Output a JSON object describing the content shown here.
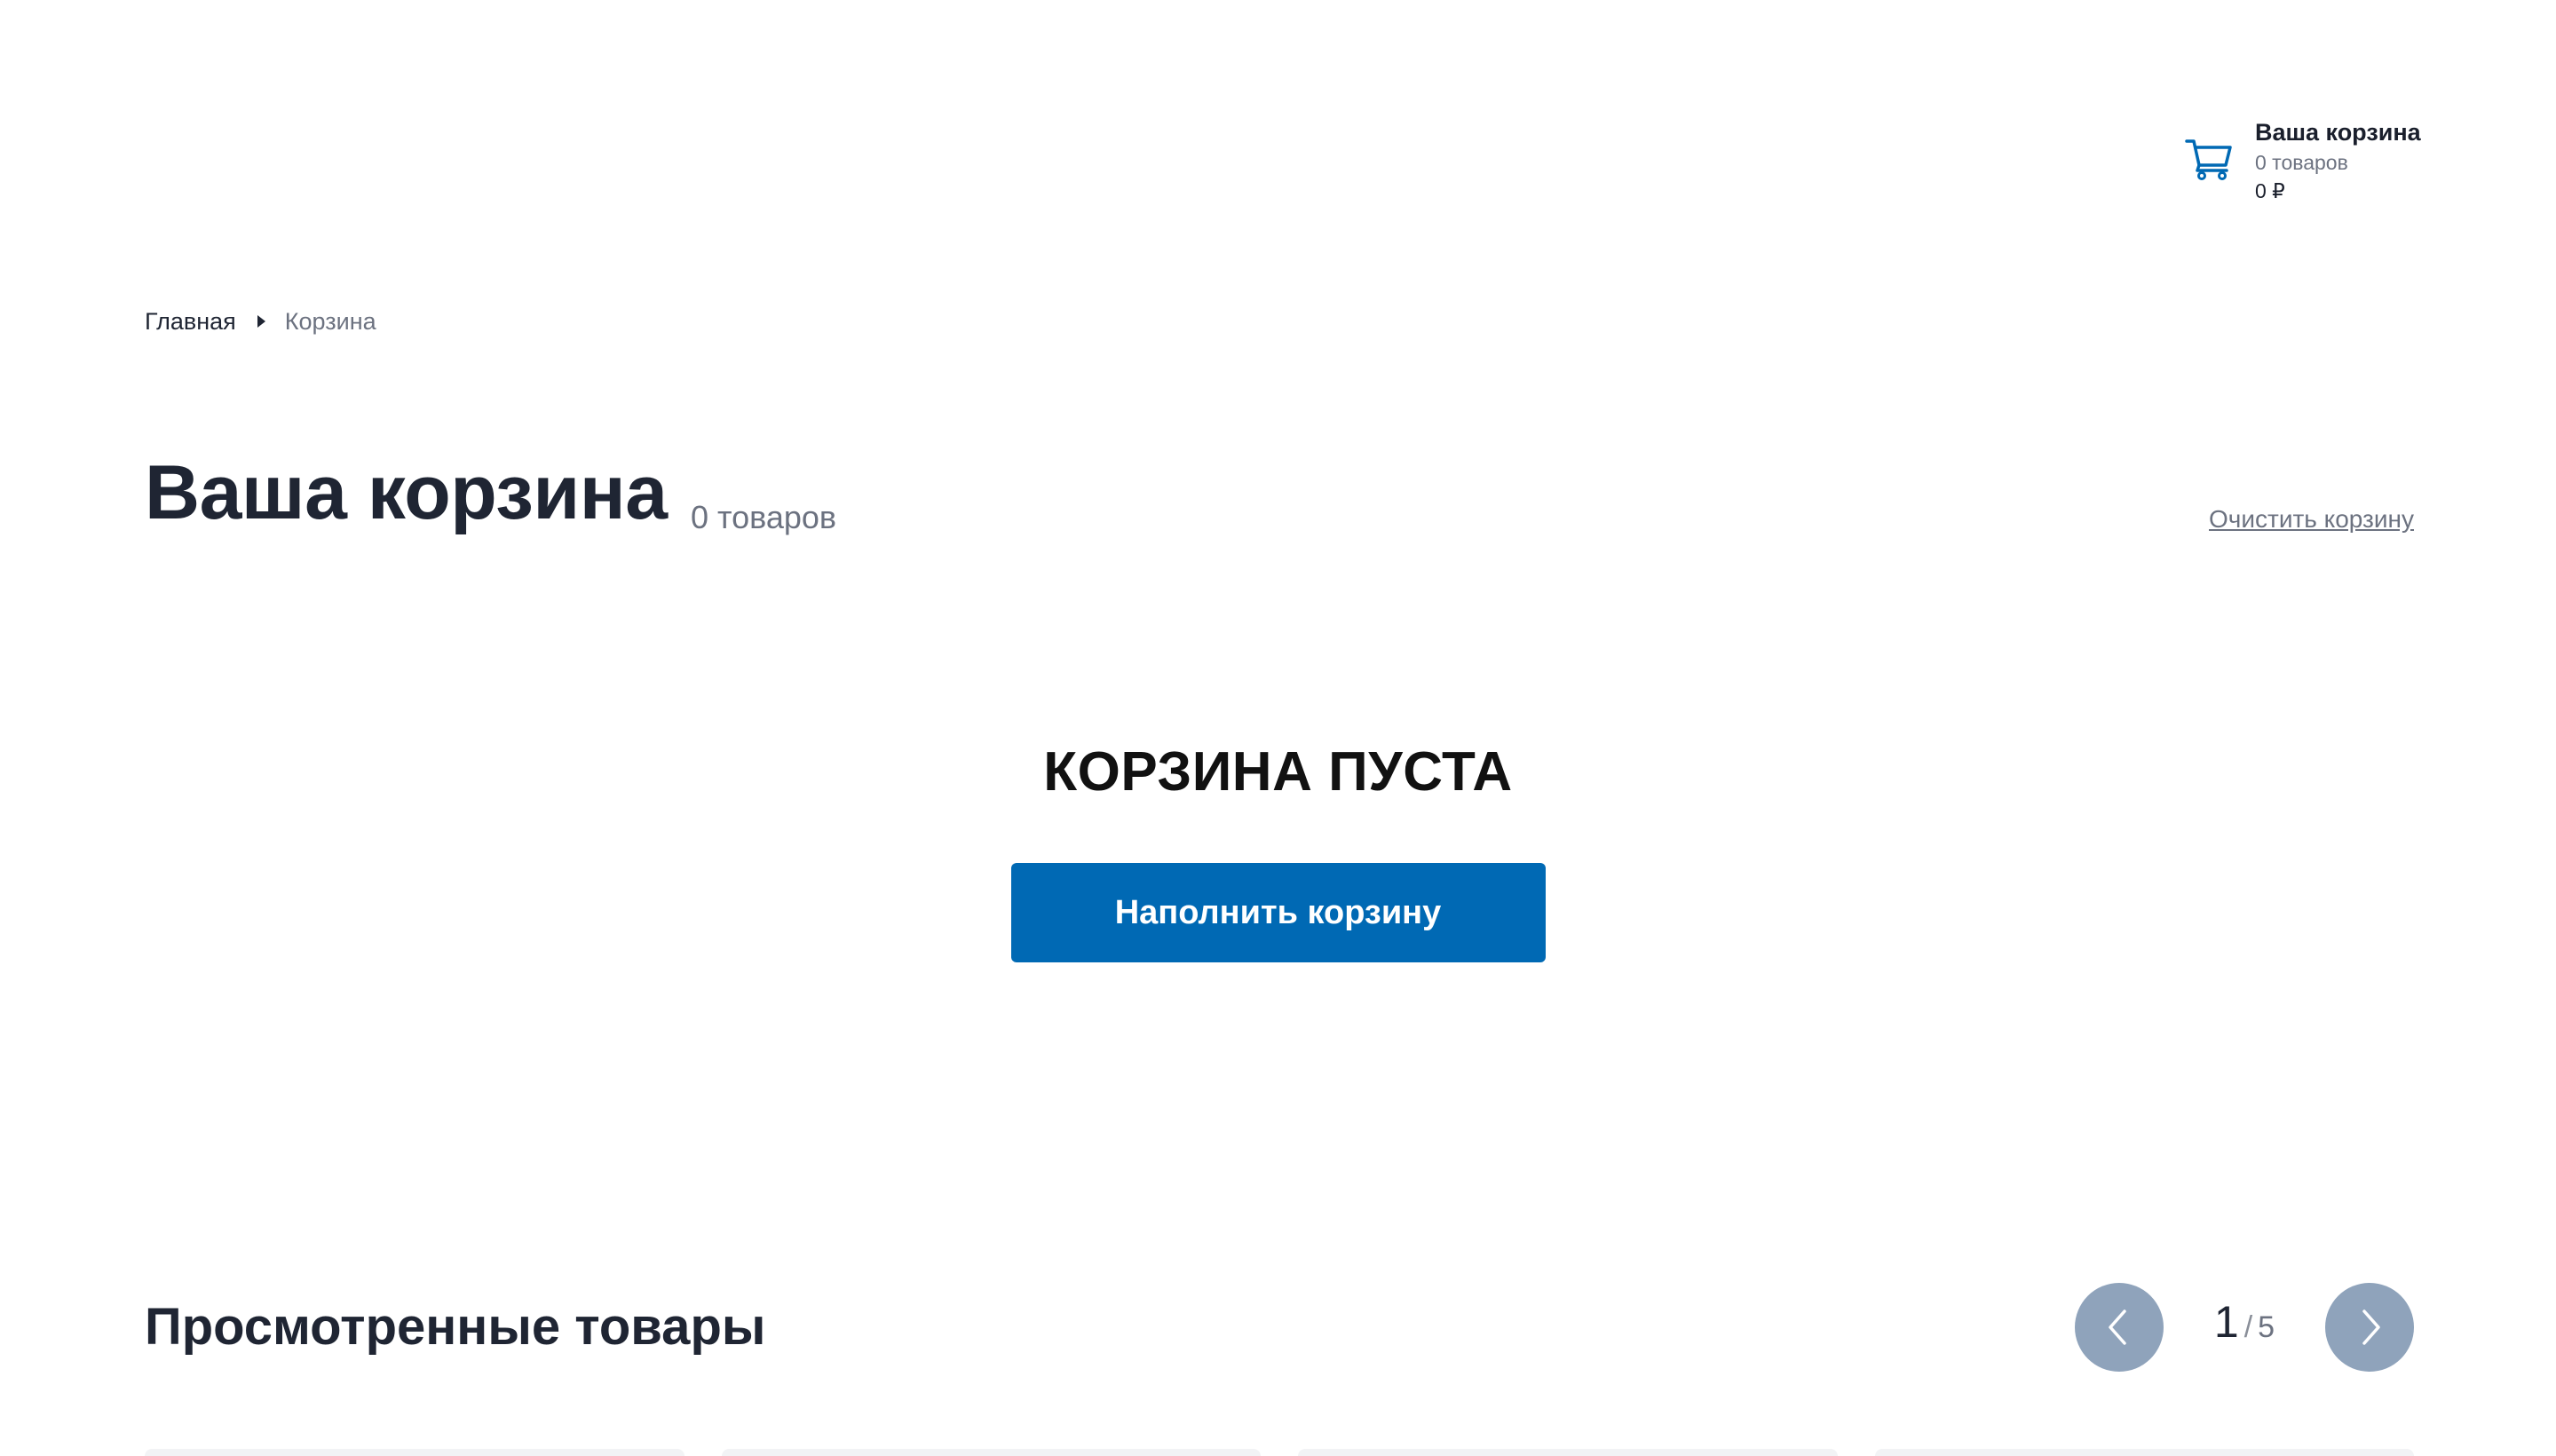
{
  "header_cart": {
    "title": "Ваша корзина",
    "count": "0 товаров",
    "total": "0 ₽",
    "icon": "cart-icon",
    "accent_color": "#0069b4"
  },
  "breadcrumb": {
    "home": "Главная",
    "current": "Корзина"
  },
  "page": {
    "title": "Ваша корзина",
    "count": "0 товаров",
    "clear_label": "Очистить корзину"
  },
  "empty_state": {
    "title": "КОРЗИНА ПУСТА",
    "button_label": "Наполнить корзину",
    "button_color": "#0069b4"
  },
  "viewed": {
    "title": "Просмотренные товары",
    "pager": {
      "current": "1",
      "separator": "/",
      "total": "5",
      "prev_icon": "chevron-left-icon",
      "next_icon": "chevron-right-icon",
      "button_color": "#8fa3bb"
    }
  }
}
